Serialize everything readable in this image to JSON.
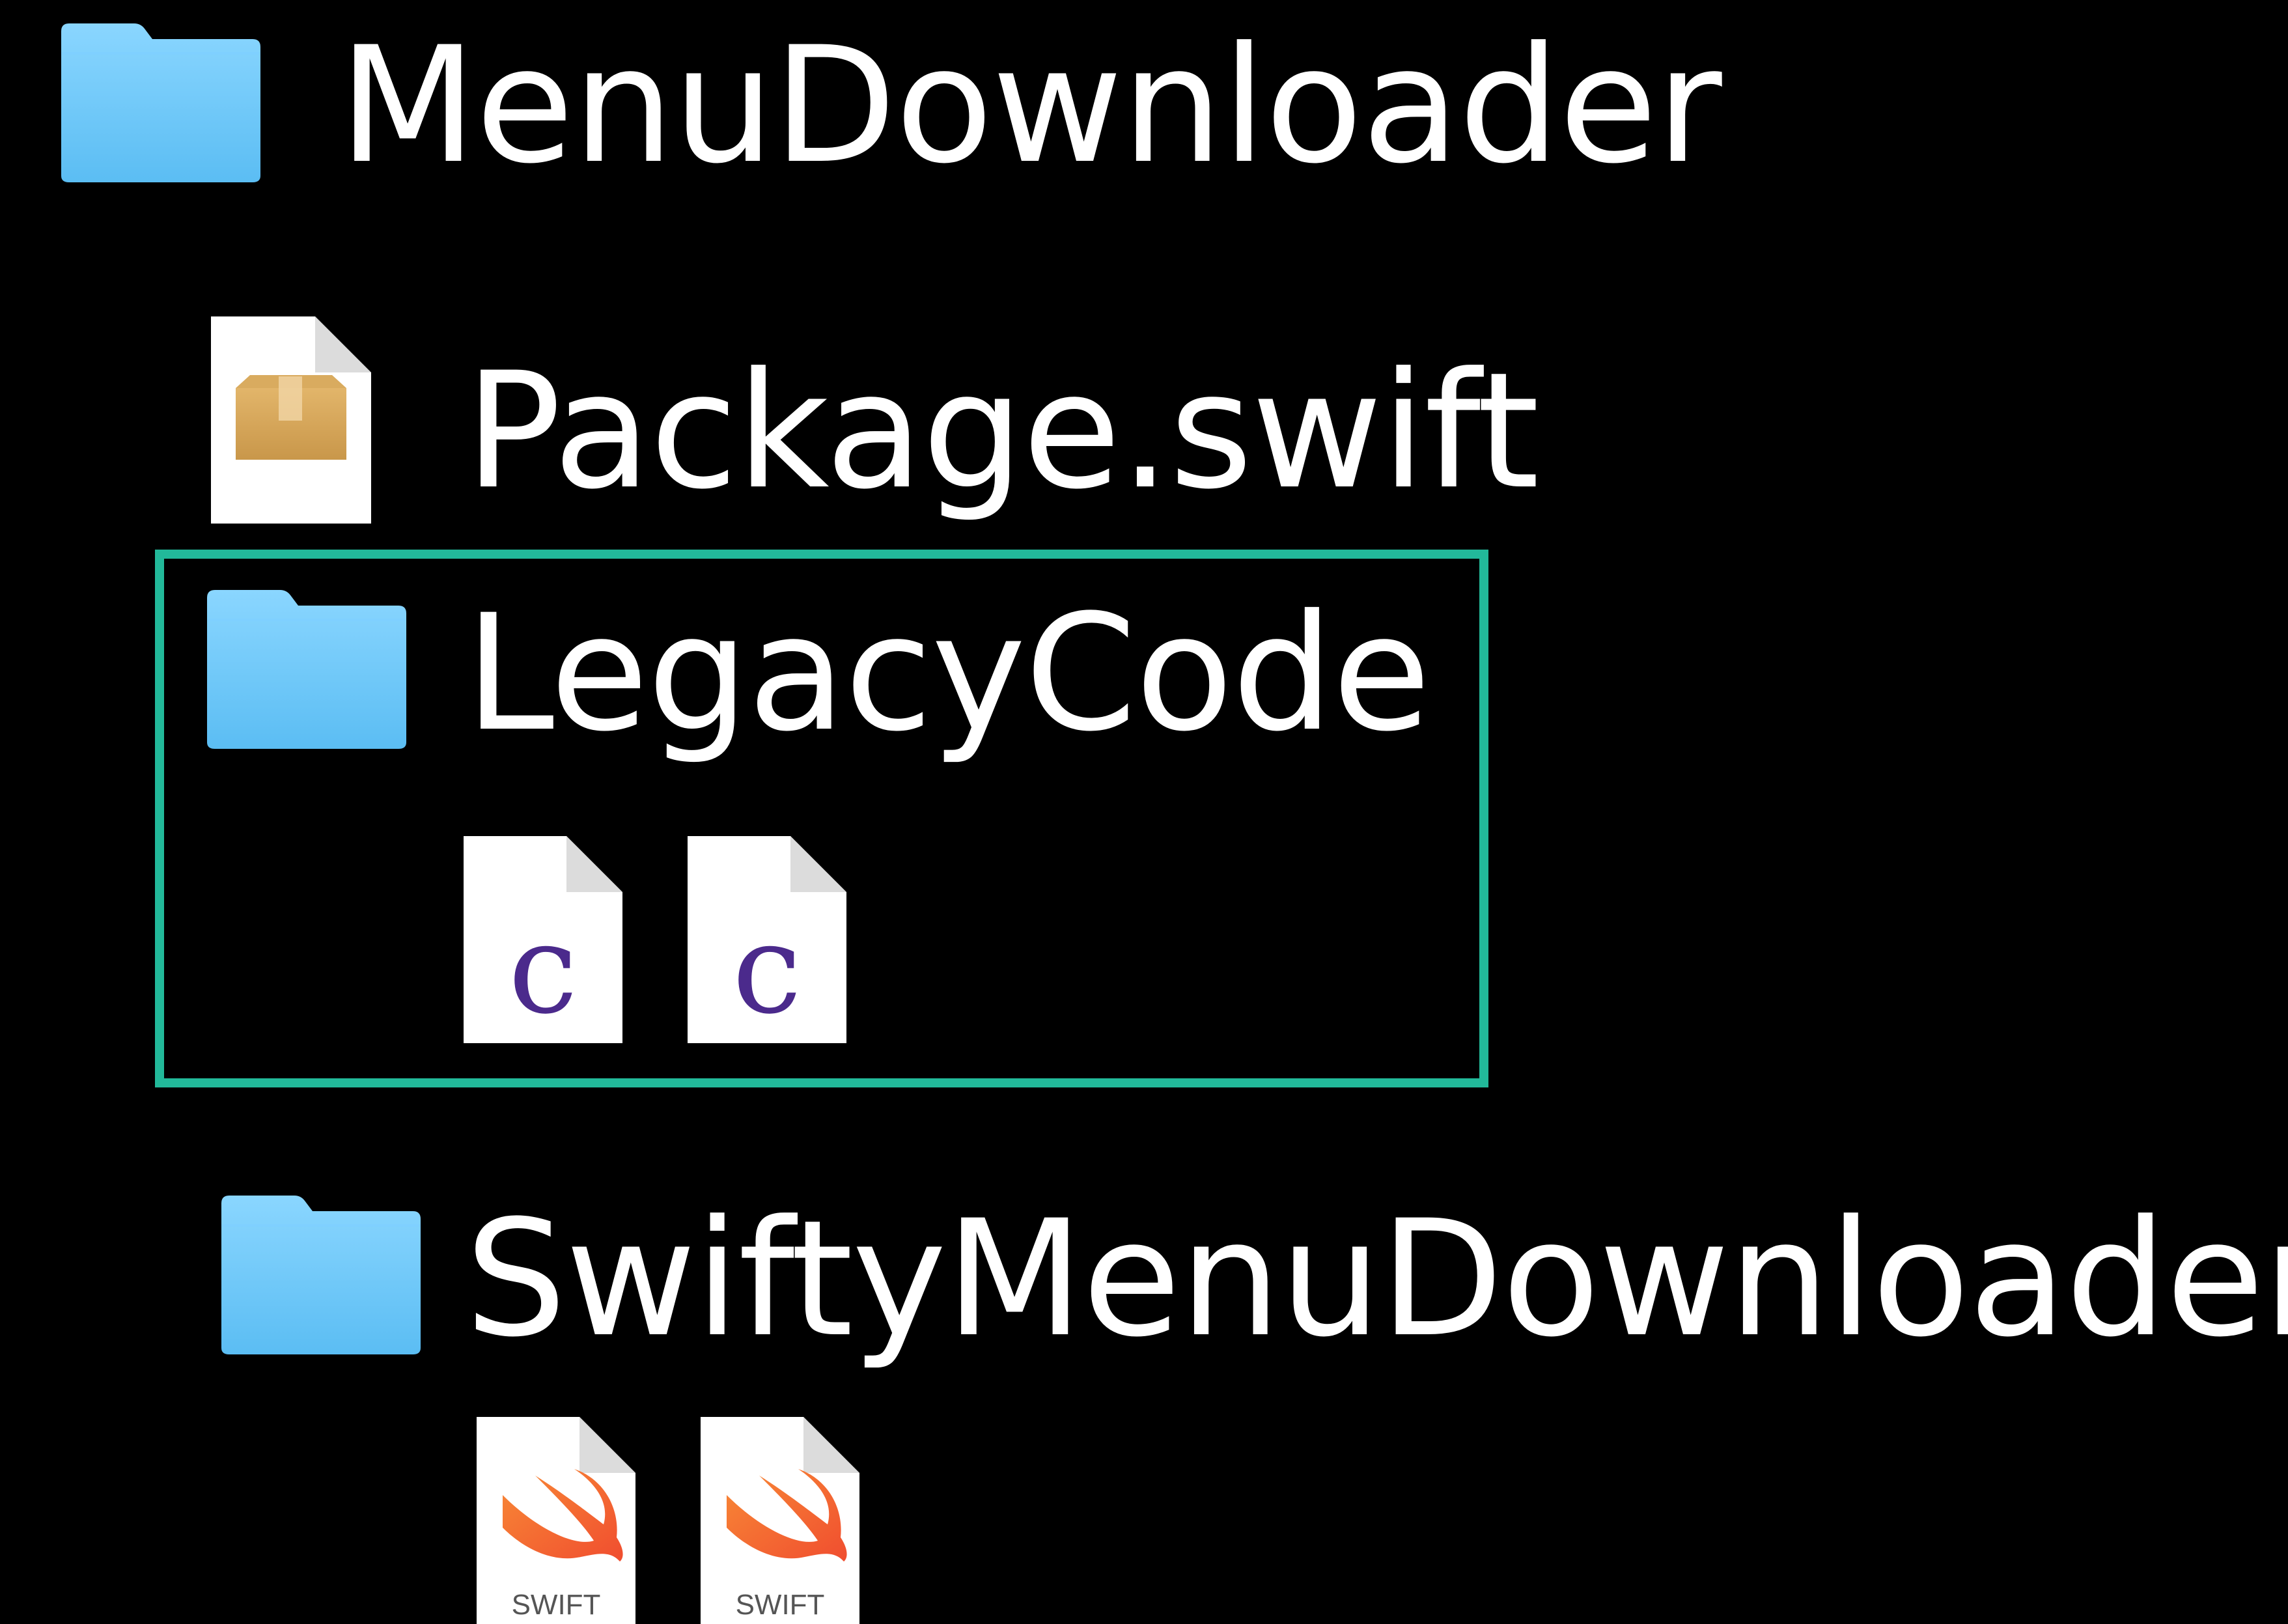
{
  "root": {
    "label": "MenuDownloader",
    "icon": "folder-icon"
  },
  "package": {
    "label": "Package.swift",
    "icon": "swift-package-icon"
  },
  "legacy": {
    "label": "LegacyCode",
    "icon": "folder-icon",
    "files": [
      {
        "icon": "c-source-file-icon",
        "glyph": "c"
      },
      {
        "icon": "c-source-file-icon",
        "glyph": "c"
      }
    ],
    "highlight_color": "#22b99a"
  },
  "swifty": {
    "label": "SwiftyMenuDownloader",
    "icon": "folder-icon",
    "files": [
      {
        "icon": "swift-file-icon",
        "caption": "SWIFT"
      },
      {
        "icon": "swift-file-icon",
        "caption": "SWIFT"
      }
    ]
  },
  "colors": {
    "background": "#000000",
    "folder": "#6cc4f7",
    "highlight": "#22b99a",
    "c_glyph": "#4b2a8c",
    "swift_orange": "#f05138"
  }
}
